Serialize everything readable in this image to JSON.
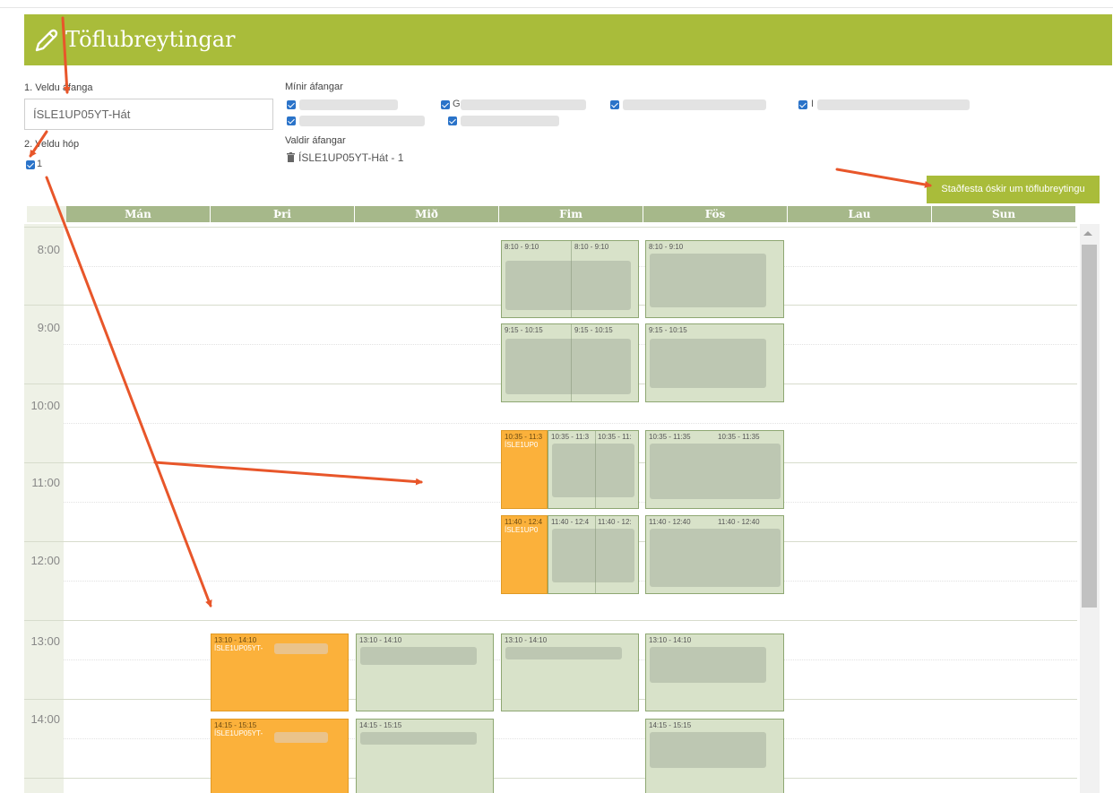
{
  "header": {
    "title": "Töflubreytingar",
    "icon": "pencil-icon",
    "color": "#a9bc3a"
  },
  "form": {
    "step1_label": "1. Veldu áfanga",
    "course_value": "ÍSLE1UP05YT-Hát",
    "step2_label": "2. Veldu hóp",
    "group_value": "1"
  },
  "my_courses": {
    "label": "Mínir áfangar",
    "first_visible_letter": "G",
    "last_visible_letter": "I"
  },
  "selected_courses": {
    "label": "Valdir áfangar",
    "item": "ÍSLE1UP05YT-Hát - 1",
    "icon": "trash-icon"
  },
  "confirm_button": "Staðfesta óskir um töflubreytingu",
  "calendar": {
    "days": [
      "Mán",
      "Þri",
      "Mið",
      "Fim",
      "Fös",
      "Lau",
      "Sun"
    ],
    "hours": [
      "8:00",
      "9:00",
      "10:00",
      "11:00",
      "12:00",
      "13:00",
      "14:00"
    ],
    "events": {
      "fim_0810_a": "8:10 - 9:10",
      "fim_0810_b": "8:10 - 9:10",
      "fos_0810": "8:10 - 9:10",
      "fim_0915_a": "9:15 - 10:15",
      "fim_0915_b": "9:15 - 10:15",
      "fos_0915": "9:15 - 10:15",
      "fim_1035_orange": "10:35 - 11:3",
      "fim_1035_orange_code": "ÍSLE1UP0",
      "fim_1035_b": "10:35 - 11:3",
      "fim_1035_c": "10:35 - 11:",
      "fos_1035_a": "10:35 - 11:35",
      "fos_1035_b": "10:35 - 11:35",
      "fim_1140_orange": "11:40 - 12:4",
      "fim_1140_orange_code": "ÍSLE1UP0",
      "fim_1140_b": "11:40 - 12:4",
      "fim_1140_c": "11:40 - 12:",
      "fos_1140_a": "11:40 - 12:40",
      "fos_1140_b": "11:40 - 12:40",
      "thri_1310": "13:10 - 14:10",
      "thri_1310_code": "ÍSLE1UP05YT-",
      "mid_1310": "13:10 - 14:10",
      "fim_1310": "13:10 - 14:10",
      "fos_1310": "13:10 - 14:10",
      "thri_1415": "14:15 - 15:15",
      "thri_1415_code": "ÍSLE1UP05YT-",
      "mid_1415": "14:15 - 15:15",
      "fos_1415": "14:15 - 15:15"
    }
  },
  "colors": {
    "event_green": "#d8e2c9",
    "event_orange": "#fbb13b",
    "day_header": "#a6b88a",
    "checkbox": "#2a73c9",
    "annotation_arrow": "#e8562a"
  }
}
